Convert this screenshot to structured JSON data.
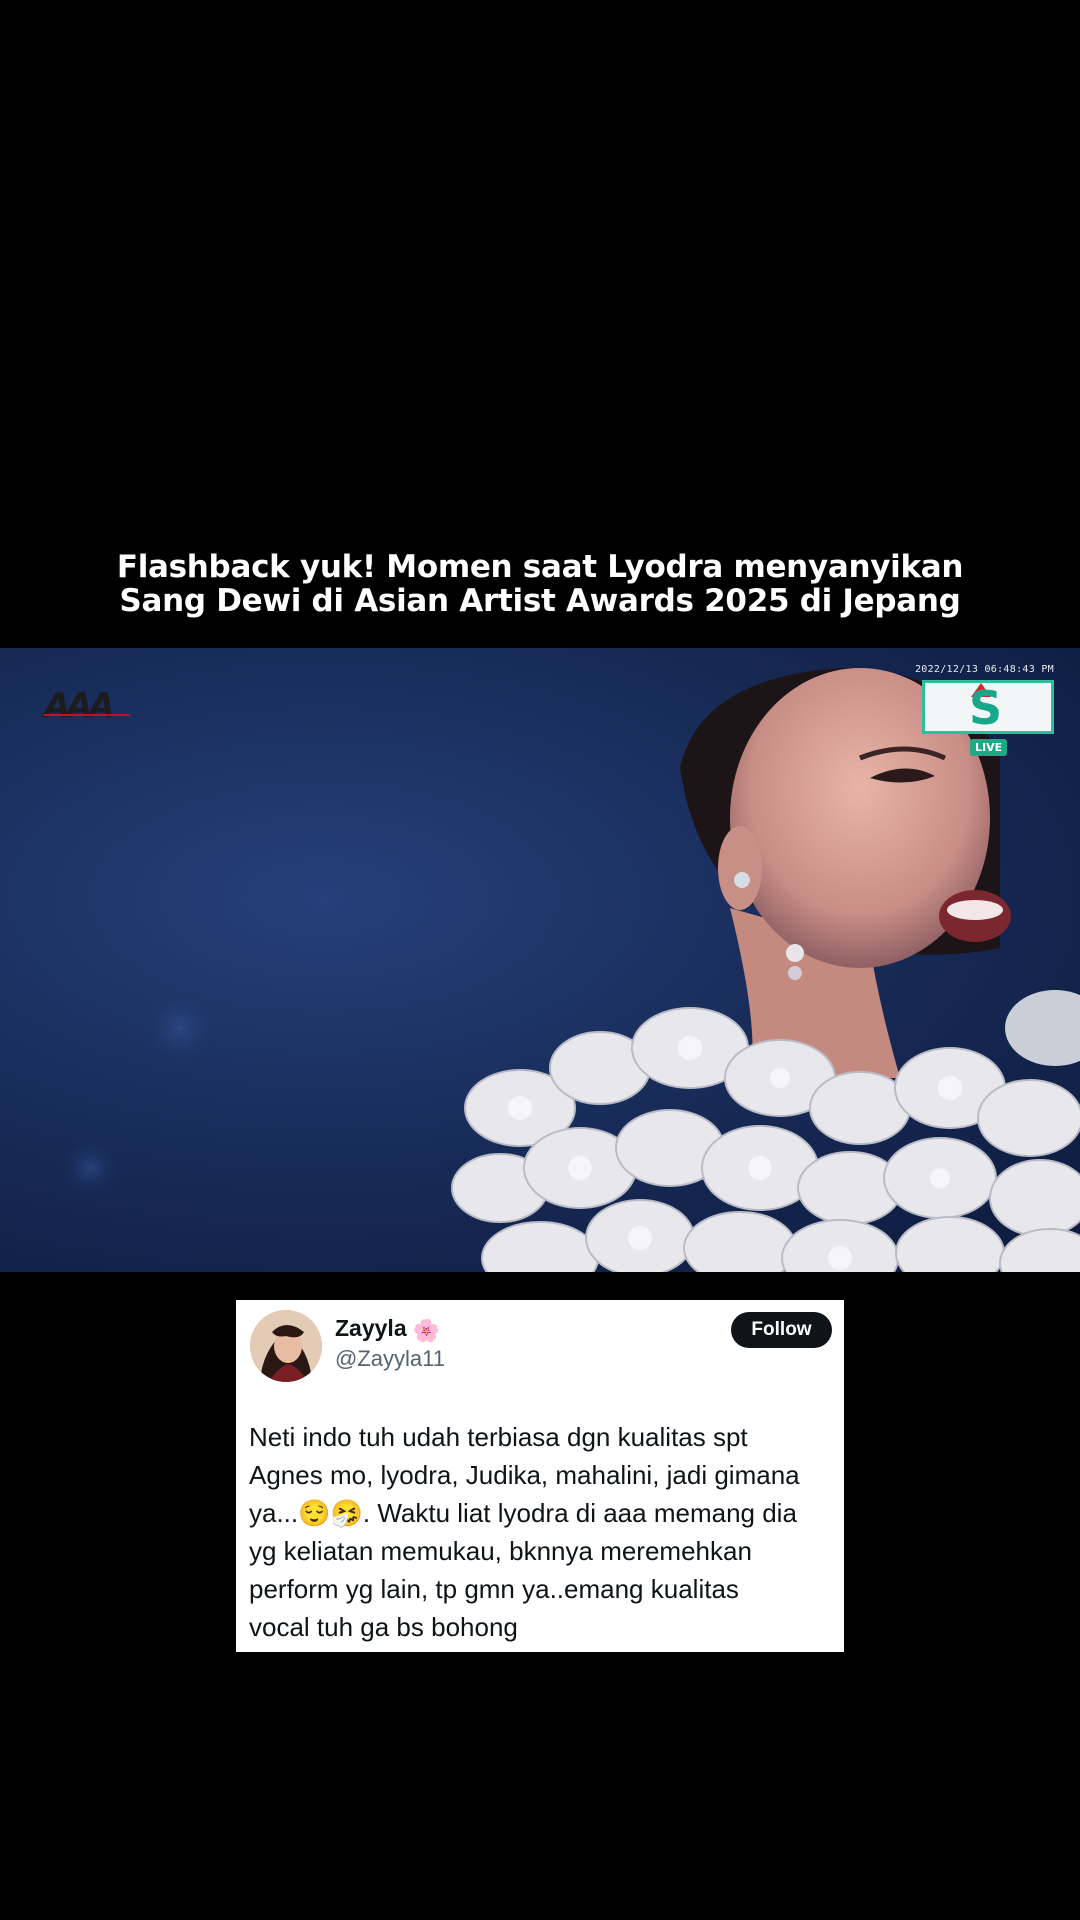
{
  "caption": {
    "line1": "Flashback yuk! Momen saat Lyodra menyanyikan",
    "line2": "Sang Dewi di Asian Artist Awards 2025 di Jepang"
  },
  "video": {
    "logo_text": "AAA",
    "timestamp": "2022/12/13 06:48:43 PM",
    "broadcaster_text": "S",
    "live_label": "LIVE"
  },
  "tweet": {
    "display_name": "Zayyla",
    "name_emoji": "🌸",
    "handle": "@Zayyla11",
    "follow_label": "Follow",
    "text_lines": [
      "Neti indo tuh udah terbiasa dgn kualitas spt",
      "Agnes mo, lyodra, Judika, mahalini, jadi gimana",
      "ya...😌🤧. Waktu liat lyodra di aaa memang dia",
      "yg keliatan memukau, bknnya meremehkan",
      "perform yg lain, tp gmn ya..emang kualitas",
      "vocal tuh ga bs bohong"
    ]
  },
  "colors": {
    "background": "#000000",
    "video_blue": "#1a2f5e",
    "follow_button": "#0f1419",
    "handle_gray": "#536471",
    "live_green": "#1fa884"
  }
}
